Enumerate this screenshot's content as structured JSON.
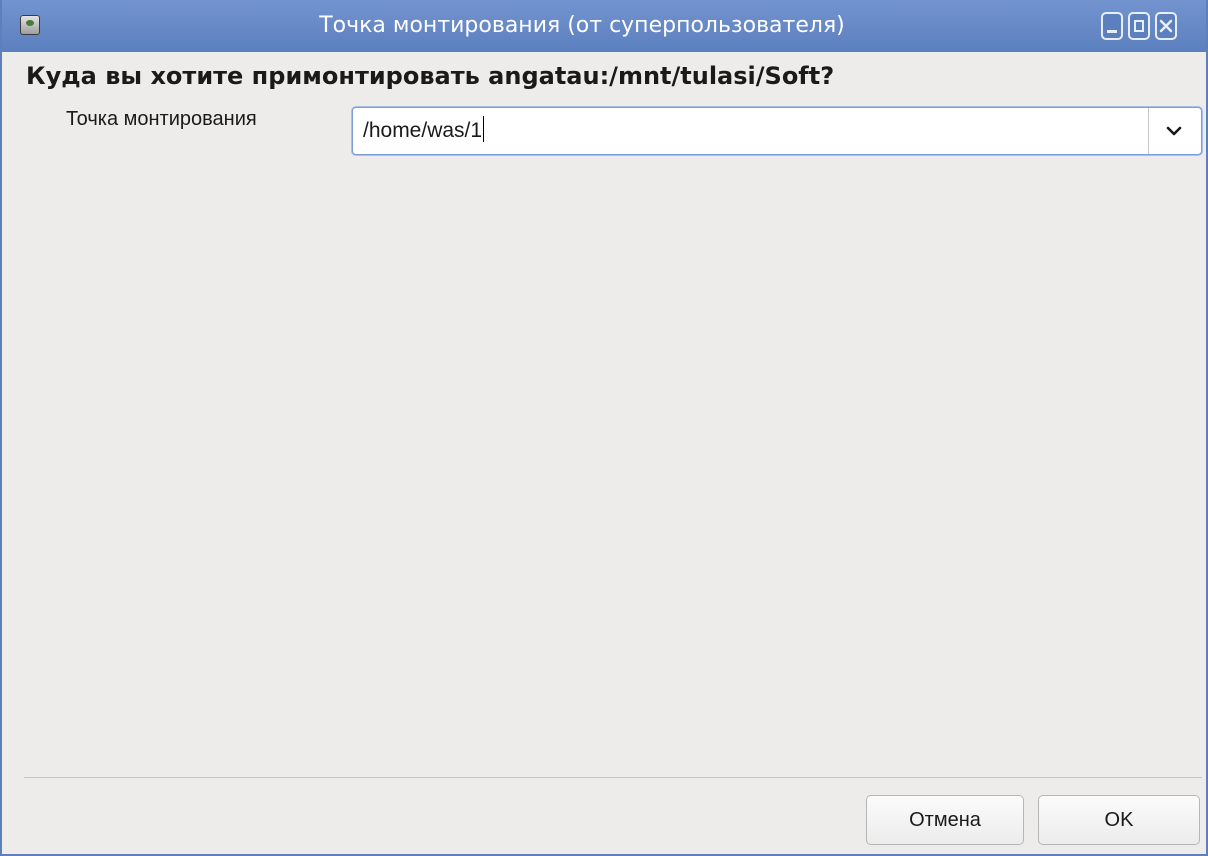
{
  "window": {
    "title": "Точка монтирования (от суперпользователя)",
    "app_icon": "drive-icon",
    "controls": [
      "minimize-icon",
      "maximize-icon",
      "close-icon"
    ],
    "accent_color": "#5c7fbe"
  },
  "dialog": {
    "heading": "Куда вы хотите примонтировать angatau:/mnt/tulasi/Soft?",
    "mount_point_label": "Точка монтирования",
    "mount_point_value": "/home/was/1",
    "dropdown_icon": "chevron-down-icon"
  },
  "buttons": {
    "cancel_label": "Отмена",
    "ok_label": "OK"
  }
}
